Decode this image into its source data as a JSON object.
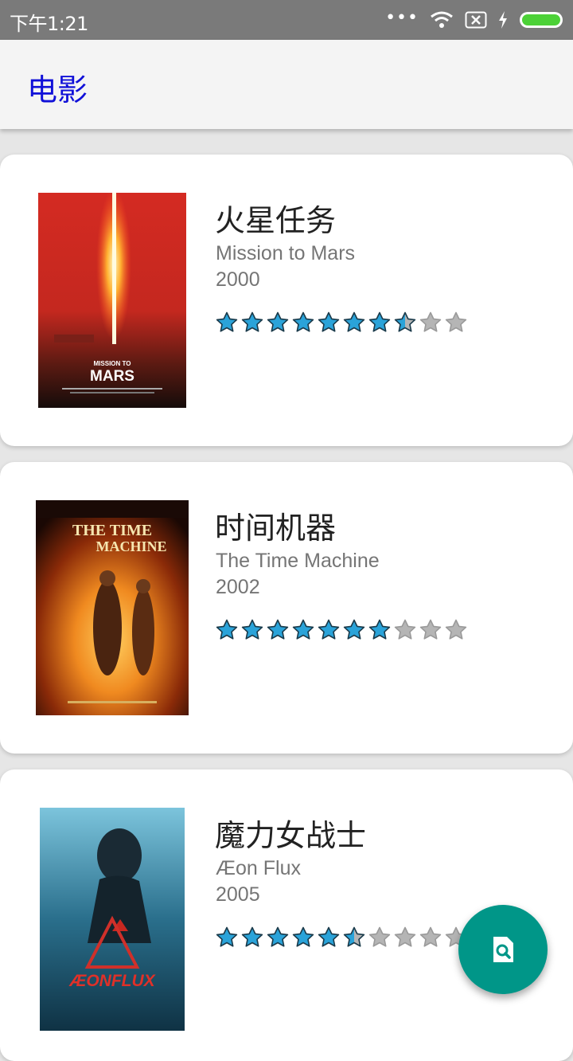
{
  "status_bar": {
    "time": "下午1:21"
  },
  "app_bar": {
    "title": "电影"
  },
  "movies": [
    {
      "title": "火星任务",
      "original_title": "Mission to Mars",
      "year": "2000",
      "rating": 3.75,
      "rating_max": 5,
      "poster_text": [
        "MISSION TO",
        "MARS"
      ]
    },
    {
      "title": "时间机器",
      "original_title": "The Time Machine",
      "year": "2002",
      "rating": 3.5,
      "rating_max": 5,
      "poster_text": [
        "THE TIME",
        "MACHINE"
      ]
    },
    {
      "title": "魔力女战士",
      "original_title": "Æon Flux",
      "year": "2005",
      "rating": 2.75,
      "rating_max": 5,
      "poster_text": [
        "ÆONFLUX"
      ]
    }
  ],
  "colors": {
    "accent": "#1010d8",
    "fab": "#009688",
    "star_filled": "#2aa3d9",
    "star_empty": "#b5b5b5"
  },
  "fab": {
    "icon": "search-document-icon"
  }
}
